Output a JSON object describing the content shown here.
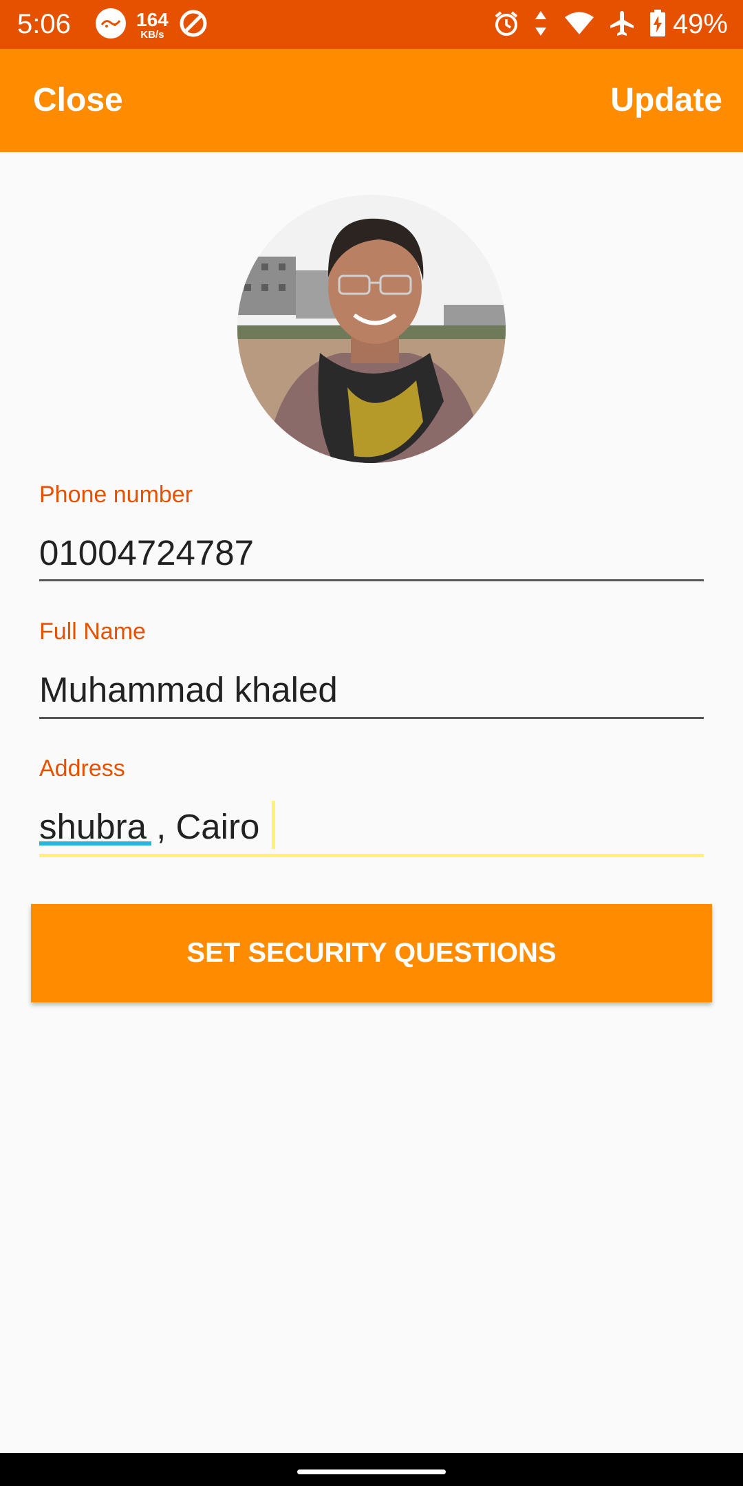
{
  "status_bar": {
    "time": "5:06",
    "netspeed_value": "164",
    "netspeed_unit": "KB/s",
    "battery_percent": "49%",
    "icons": [
      "app-notification-icon",
      "network-speed-indicator",
      "data-saver-icon",
      "alarm-icon",
      "data-transfer-icon",
      "wifi-icon",
      "airplane-mode-icon",
      "battery-charging-icon"
    ],
    "background_color": "#e65100"
  },
  "toolbar": {
    "close_label": "Close",
    "update_label": "Update",
    "background_color": "#ff8c00"
  },
  "profile": {
    "avatar": "profile-photo"
  },
  "form": {
    "phone": {
      "label": "Phone number",
      "value": "01004724787"
    },
    "full_name": {
      "label": "Full Name",
      "value": "Muhammad khaled"
    },
    "address": {
      "label": "Address",
      "value": "shubra , Cairo"
    }
  },
  "actions": {
    "security_questions_label": "SET SECURITY QUESTIONS"
  },
  "colors": {
    "accent": "#ff8c00",
    "label": "#e65100",
    "focus_underline": "#fff176",
    "spellcheck_underline": "#29b6d6"
  }
}
